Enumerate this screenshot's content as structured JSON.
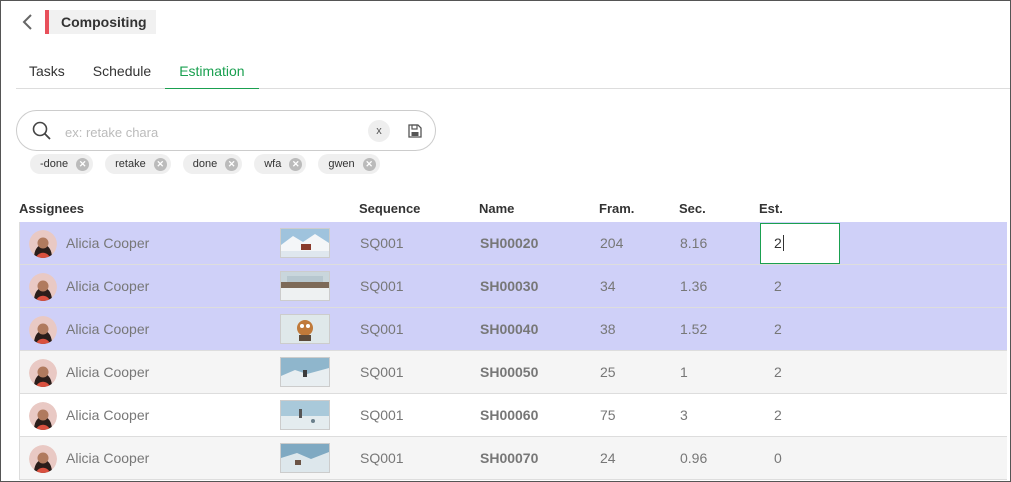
{
  "header": {
    "title": "Compositing",
    "accent_color": "#e8505b"
  },
  "tabs": [
    {
      "label": "Tasks",
      "active": false
    },
    {
      "label": "Schedule",
      "active": false
    },
    {
      "label": "Estimation",
      "active": true
    }
  ],
  "search": {
    "placeholder": "ex: retake chara",
    "value": "",
    "clear_label": "x"
  },
  "filters": [
    "-done",
    "retake",
    "done",
    "wfa",
    "gwen"
  ],
  "table": {
    "columns": {
      "assignees": "Assignees",
      "sequence": "Sequence",
      "name": "Name",
      "frames": "Fram.",
      "seconds": "Sec.",
      "estimation": "Est."
    },
    "rows": [
      {
        "assignee": "Alicia Cooper",
        "sequence": "SQ001",
        "name": "SH00020",
        "frames": "204",
        "seconds": "8.16",
        "estimation": "2",
        "selected": true,
        "editing": true
      },
      {
        "assignee": "Alicia Cooper",
        "sequence": "SQ001",
        "name": "SH00030",
        "frames": "34",
        "seconds": "1.36",
        "estimation": "2",
        "selected": true,
        "editing": false
      },
      {
        "assignee": "Alicia Cooper",
        "sequence": "SQ001",
        "name": "SH00040",
        "frames": "38",
        "seconds": "1.52",
        "estimation": "2",
        "selected": true,
        "editing": false
      },
      {
        "assignee": "Alicia Cooper",
        "sequence": "SQ001",
        "name": "SH00050",
        "frames": "25",
        "seconds": "1",
        "estimation": "2",
        "selected": false,
        "editing": false
      },
      {
        "assignee": "Alicia Cooper",
        "sequence": "SQ001",
        "name": "SH00060",
        "frames": "75",
        "seconds": "3",
        "estimation": "2",
        "selected": false,
        "editing": false
      },
      {
        "assignee": "Alicia Cooper",
        "sequence": "SQ001",
        "name": "SH00070",
        "frames": "24",
        "seconds": "0.96",
        "estimation": "0",
        "selected": false,
        "editing": false
      }
    ]
  },
  "colors": {
    "accent_green": "#1aa050",
    "selected_row": "#cfd0f8"
  },
  "icons": {
    "back": "chevron-left-icon",
    "search": "search-icon",
    "save": "save-icon",
    "tag_remove": "close-circle-icon"
  }
}
